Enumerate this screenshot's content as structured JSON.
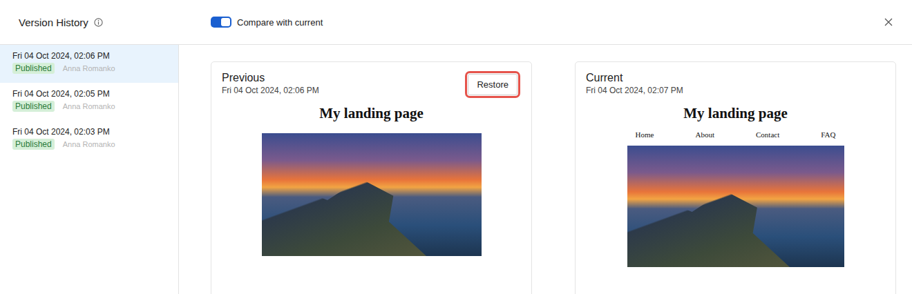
{
  "header": {
    "title": "Version History",
    "compare_toggle": {
      "label": "Compare with current",
      "on": true
    }
  },
  "versions": [
    {
      "date": "Fri 04 Oct 2024, 02:06 PM",
      "status": "Published",
      "author": "Anna Romanko",
      "selected": true
    },
    {
      "date": "Fri 04 Oct 2024, 02:05 PM",
      "status": "Published",
      "author": "Anna Romanko",
      "selected": false
    },
    {
      "date": "Fri 04 Oct 2024, 02:03 PM",
      "status": "Published",
      "author": "Anna Romanko",
      "selected": false
    }
  ],
  "panels": [
    {
      "title": "Previous",
      "date": "Fri 04 Oct 2024, 02:06 PM",
      "actions": [
        {
          "label": "Restore",
          "highlighted": true
        }
      ],
      "page": {
        "heading": "My landing page",
        "nav": []
      }
    },
    {
      "title": "Current",
      "date": "Fri 04 Oct 2024, 02:07 PM",
      "actions": [],
      "page": {
        "heading": "My landing page",
        "nav": [
          "Home",
          "About",
          "Contact",
          "FAQ"
        ]
      }
    }
  ]
}
